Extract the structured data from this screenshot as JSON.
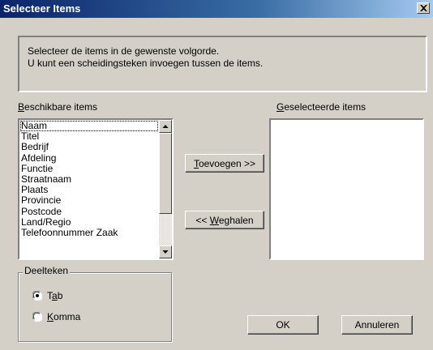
{
  "window": {
    "title": "Selecteer Items",
    "close_label": "×"
  },
  "instructions": {
    "line1": "Selecteer de items in de gewenste volgorde.",
    "line2": "U kunt een scheidingsteken invoegen tussen de items."
  },
  "available": {
    "label_accel": "B",
    "label_rest": "eschikbare items",
    "items": [
      "Naam",
      "Titel",
      "Bedrijf",
      "Afdeling",
      "Functie",
      "Straatnaam",
      "Plaats",
      "Provincie",
      "Postcode",
      "Land/Regio",
      "Telefoonnummer Zaak"
    ]
  },
  "selected": {
    "label_accel": "G",
    "label_rest": "eselecteerde items",
    "items": []
  },
  "buttons": {
    "add_accel": "T",
    "add_rest": "oevoegen >>",
    "remove_pre": "<< ",
    "remove_accel": "W",
    "remove_rest": "eghalen",
    "ok": "OK",
    "cancel": "Annuleren"
  },
  "separator": {
    "title": "Deelteken",
    "options": [
      {
        "pre": "T",
        "accel": "a",
        "post": "b",
        "checked": true
      },
      {
        "pre": "",
        "accel": "K",
        "post": "omma",
        "checked": false
      }
    ]
  },
  "icons": {
    "close": "close-icon",
    "scroll_up": "arrow-up-icon",
    "scroll_down": "arrow-down-icon"
  }
}
